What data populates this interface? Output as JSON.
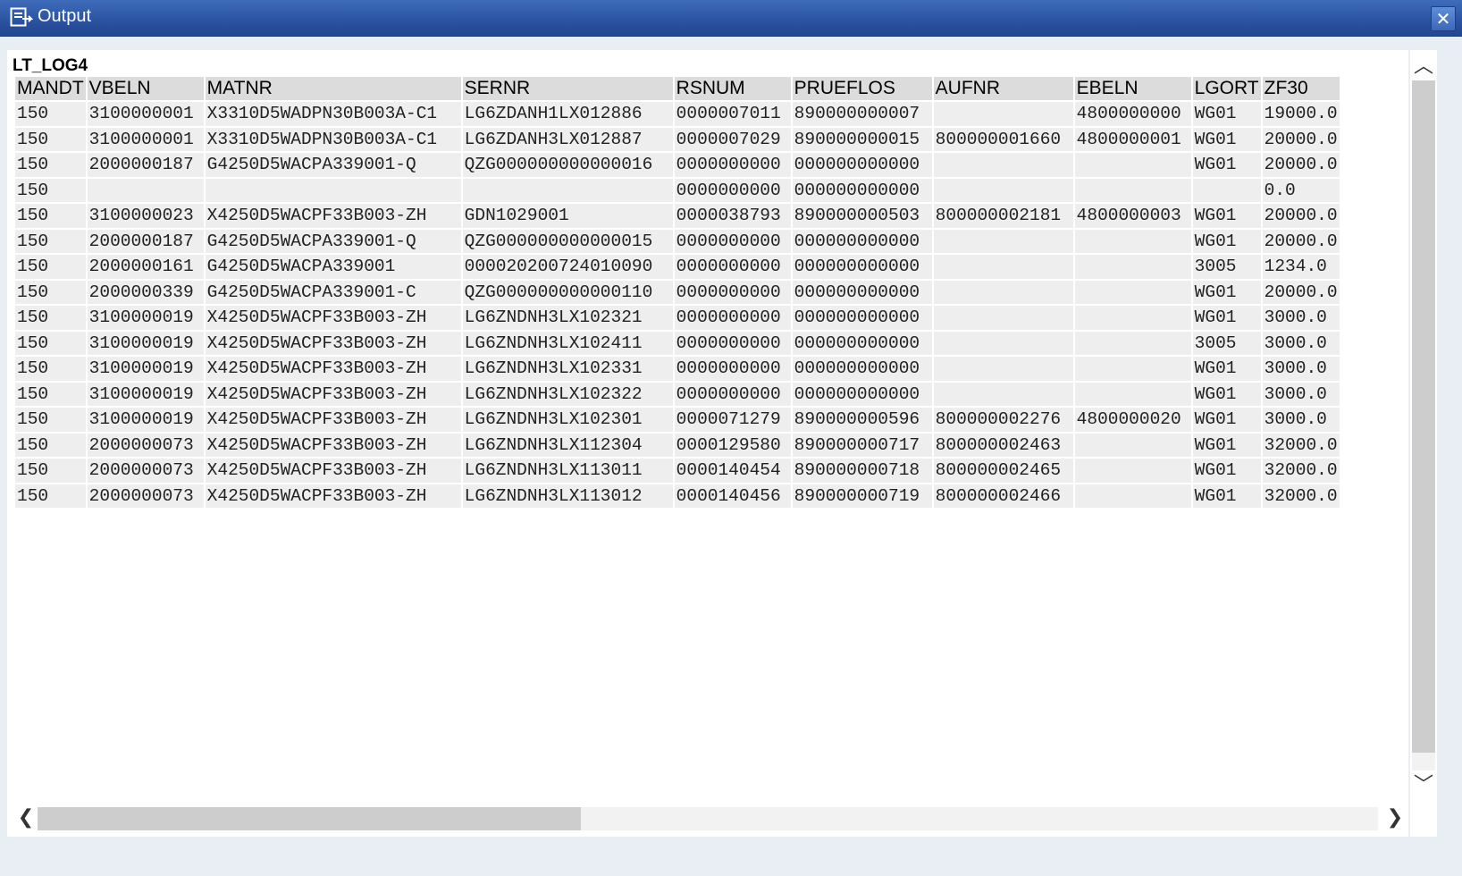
{
  "window": {
    "title": "Output",
    "close_symbol": "✕"
  },
  "list_title": "LT_LOG4",
  "columns": [
    "MANDT",
    "VBELN",
    "MATNR",
    "SERNR",
    "RSNUM",
    "PRUEFLOS",
    "AUFNR",
    "EBELN",
    "LGORT",
    "ZF30"
  ],
  "rows": [
    [
      "150",
      "3100000001",
      "X3310D5WADPN30B003A-C1",
      "LG6ZDANH1LX012886",
      "0000007011",
      "890000000007",
      "",
      "4800000000",
      "WG01",
      "19000.0"
    ],
    [
      "150",
      "3100000001",
      "X3310D5WADPN30B003A-C1",
      "LG6ZDANH3LX012887",
      "0000007029",
      "890000000015",
      "800000001660",
      "4800000001",
      "WG01",
      "20000.0"
    ],
    [
      "150",
      "2000000187",
      "G4250D5WACPA339001-Q",
      "QZG000000000000016",
      "0000000000",
      "000000000000",
      "",
      "",
      "WG01",
      "20000.0"
    ],
    [
      "150",
      "",
      "",
      "",
      "0000000000",
      "000000000000",
      "",
      "",
      "",
      "0.0"
    ],
    [
      "150",
      "3100000023",
      "X4250D5WACPF33B003-ZH",
      "GDN1029001",
      "0000038793",
      "890000000503",
      "800000002181",
      "4800000003",
      "WG01",
      "20000.0"
    ],
    [
      "150",
      "2000000187",
      "G4250D5WACPA339001-Q",
      "QZG000000000000015",
      "0000000000",
      "000000000000",
      "",
      "",
      "WG01",
      "20000.0"
    ],
    [
      "150",
      "2000000161",
      "G4250D5WACPA339001",
      "000020200724010090",
      "0000000000",
      "000000000000",
      "",
      "",
      "3005",
      "1234.0"
    ],
    [
      "150",
      "2000000339",
      "G4250D5WACPA339001-C",
      "QZG000000000000110",
      "0000000000",
      "000000000000",
      "",
      "",
      "WG01",
      "20000.0"
    ],
    [
      "150",
      "3100000019",
      "X4250D5WACPF33B003-ZH",
      "LG6ZNDNH3LX102321",
      "0000000000",
      "000000000000",
      "",
      "",
      "WG01",
      "3000.0"
    ],
    [
      "150",
      "3100000019",
      "X4250D5WACPF33B003-ZH",
      "LG6ZNDNH3LX102411",
      "0000000000",
      "000000000000",
      "",
      "",
      "3005",
      "3000.0"
    ],
    [
      "150",
      "3100000019",
      "X4250D5WACPF33B003-ZH",
      "LG6ZNDNH3LX102331",
      "0000000000",
      "000000000000",
      "",
      "",
      "WG01",
      "3000.0"
    ],
    [
      "150",
      "3100000019",
      "X4250D5WACPF33B003-ZH",
      "LG6ZNDNH3LX102322",
      "0000000000",
      "000000000000",
      "",
      "",
      "WG01",
      "3000.0"
    ],
    [
      "150",
      "3100000019",
      "X4250D5WACPF33B003-ZH",
      "LG6ZNDNH3LX102301",
      "0000071279",
      "890000000596",
      "800000002276",
      "4800000020",
      "WG01",
      "3000.0"
    ],
    [
      "150",
      "2000000073",
      "X4250D5WACPF33B003-ZH",
      "LG6ZNDNH3LX112304",
      "0000129580",
      "890000000717",
      "800000002463",
      "",
      "WG01",
      "32000.0"
    ],
    [
      "150",
      "2000000073",
      "X4250D5WACPF33B003-ZH",
      "LG6ZNDNH3LX113011",
      "0000140454",
      "890000000718",
      "800000002465",
      "",
      "WG01",
      "32000.0"
    ],
    [
      "150",
      "2000000073",
      "X4250D5WACPF33B003-ZH",
      "LG6ZNDNH3LX113012",
      "0000140456",
      "890000000719",
      "800000002466",
      "",
      "WG01",
      "32000.0"
    ]
  ],
  "icons": {
    "title": "output-list-icon",
    "scroll_up": "chevron-up-icon",
    "scroll_down": "chevron-down-icon",
    "scroll_left": "chevron-left-icon",
    "scroll_right": "chevron-right-icon"
  },
  "arrows": {
    "up": "︿",
    "down": "﹀",
    "left": "❮",
    "right": "❯"
  },
  "colors": {
    "titlebar": "#2a52a0",
    "header_cell": "#dcdcdc",
    "data_cell": "#eeeeee",
    "scroll_thumb": "#cdcdcd"
  }
}
